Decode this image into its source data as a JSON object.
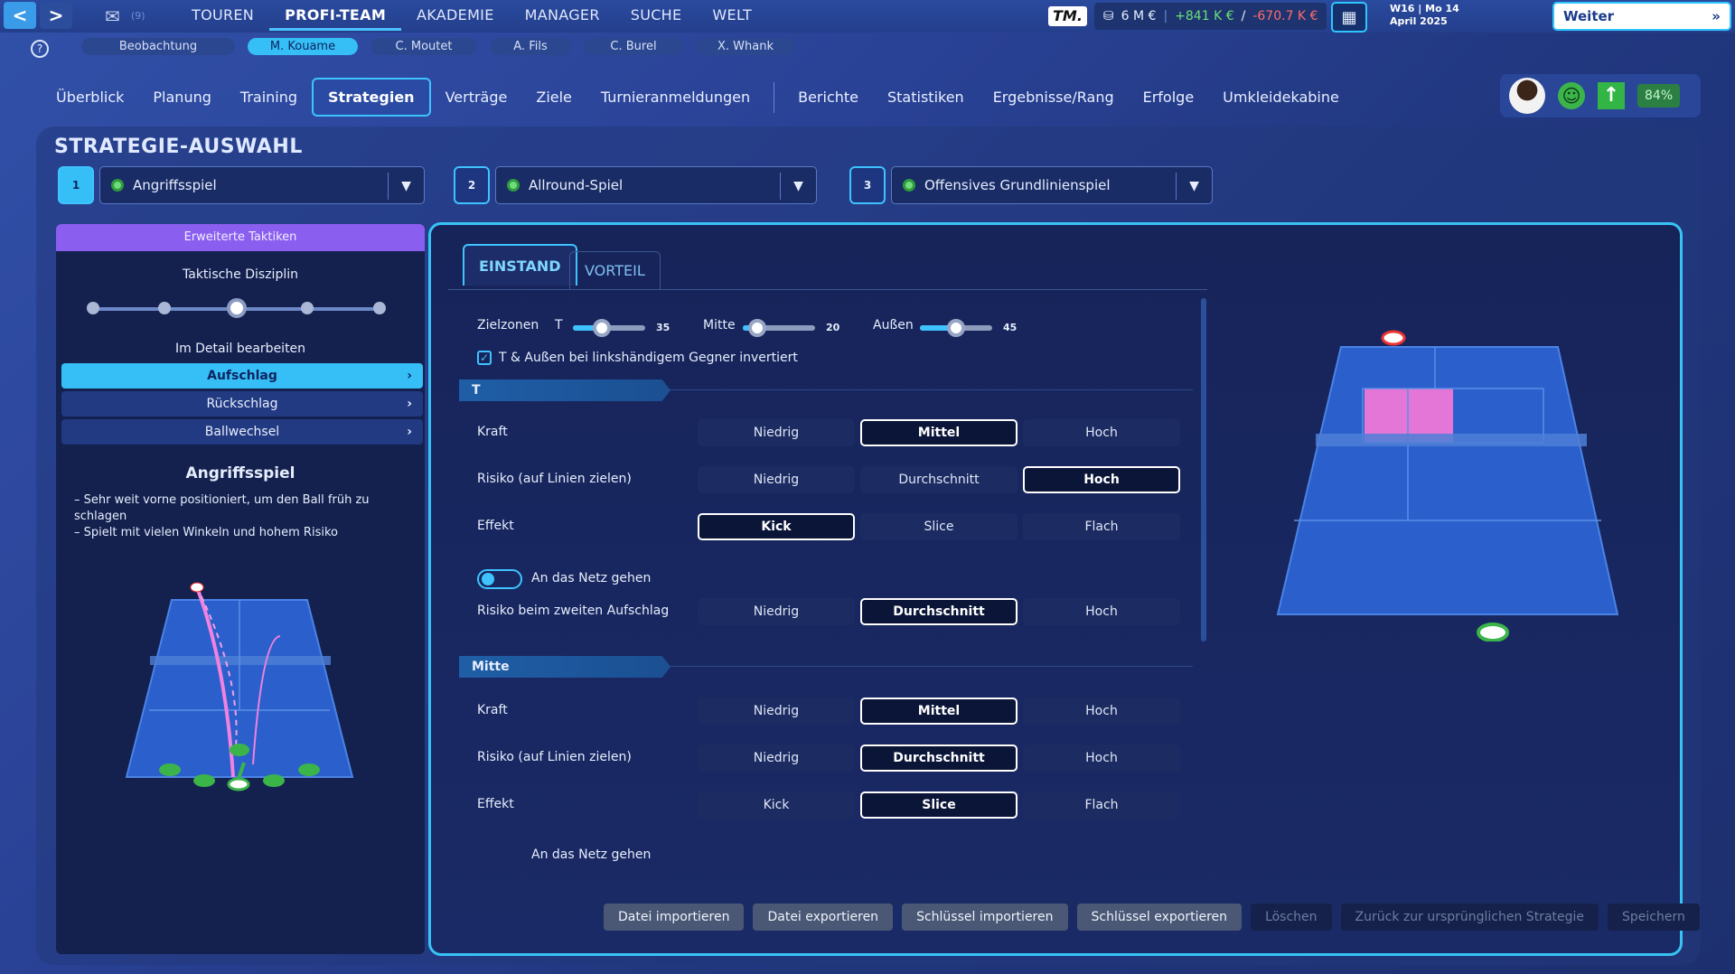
{
  "topbar": {
    "back": "<",
    "forward": ">",
    "mail_count": "(9)",
    "menu": [
      "TOUREN",
      "PROFI-TEAM",
      "AKADEMIE",
      "MANAGER",
      "SUCHE",
      "WELT"
    ],
    "logo": "TM.",
    "balance": "6 M €",
    "income": "+841 K €",
    "slash": "/",
    "expense": "-670.7 K €",
    "week": "W16 | Mo 14",
    "date": "April 2025",
    "continue": "Weiter",
    "continue_icon": "»"
  },
  "players": [
    "Beobachtung",
    "M. Kouame",
    "C. Moutet",
    "A. Fils",
    "C. Burel",
    "X. Whank"
  ],
  "help": "?",
  "subnav": [
    "Überblick",
    "Planung",
    "Training",
    "Strategien",
    "Verträge",
    "Ziele",
    "Turnieranmeldungen",
    "Berichte",
    "Statistiken",
    "Ergebnisse/Rang",
    "Erfolge",
    "Umkleidekabine"
  ],
  "status": {
    "percent": "84%",
    "mood_icon": "☺",
    "trend_icon": "↑"
  },
  "title": "STRATEGIE-AUSWAHL",
  "strategies": [
    {
      "num": "1",
      "name": "Angriffsspiel"
    },
    {
      "num": "2",
      "name": "Allround-Spiel"
    },
    {
      "num": "3",
      "name": "Offensives Grundlinienspiel"
    }
  ],
  "left": {
    "header": "Erweiterte Taktiken",
    "discipline": "Taktische Disziplin",
    "discipline_level": 3,
    "discipline_steps": 5,
    "edit_label": "Im Detail bearbeiten",
    "items": [
      "Aufschlag",
      "Rückschlag",
      "Ballwechsel"
    ],
    "strategy_name": "Angriffsspiel",
    "desc": [
      "– Sehr weit vorne positioniert, um den Ball früh zu schlagen",
      "– Spielt mit vielen Winkeln und hohem Risiko"
    ]
  },
  "tabs": {
    "einstand": "EINSTAND",
    "vorteil": "VORTEIL"
  },
  "zones": {
    "label": "Zielzonen",
    "t_label": "T",
    "t_val": "35",
    "mitte_label": "Mitte",
    "mitte_val": "20",
    "aussen_label": "Außen",
    "aussen_val": "45",
    "invert_label": "T & Außen bei linkshändigem Gegner invertiert",
    "invert_checked": true
  },
  "sections": [
    {
      "name": "T",
      "rows": [
        {
          "label": "Kraft",
          "options": [
            "Niedrig",
            "Mittel",
            "Hoch"
          ],
          "selected": 1
        },
        {
          "label": "Risiko (auf Linien zielen)",
          "options": [
            "Niedrig",
            "Durchschnitt",
            "Hoch"
          ],
          "selected": 2
        },
        {
          "label": "Effekt",
          "options": [
            "Kick",
            "Slice",
            "Flach"
          ],
          "selected": 0
        }
      ],
      "net_label": "An das Netz gehen",
      "net_on": true,
      "second": {
        "label": "Risiko beim zweiten Aufschlag",
        "options": [
          "Niedrig",
          "Durchschnitt",
          "Hoch"
        ],
        "selected": 1
      }
    },
    {
      "name": "Mitte",
      "rows": [
        {
          "label": "Kraft",
          "options": [
            "Niedrig",
            "Mittel",
            "Hoch"
          ],
          "selected": 1
        },
        {
          "label": "Risiko (auf Linien zielen)",
          "options": [
            "Niedrig",
            "Durchschnitt",
            "Hoch"
          ],
          "selected": 1
        },
        {
          "label": "Effekt",
          "options": [
            "Kick",
            "Slice",
            "Flach"
          ],
          "selected": 1
        }
      ],
      "net_label": "An das Netz gehen"
    }
  ],
  "buttons": [
    "Datei importieren",
    "Datei exportieren",
    "Schlüssel importieren",
    "Schlüssel exportieren",
    "Löschen",
    "Zurück zur ursprünglichen Strategie",
    "Speichern"
  ],
  "colors": {
    "accent": "#36bff7",
    "purple": "#8a5ff0",
    "target_zone": "#e476d8",
    "green": "#3bb44a"
  }
}
